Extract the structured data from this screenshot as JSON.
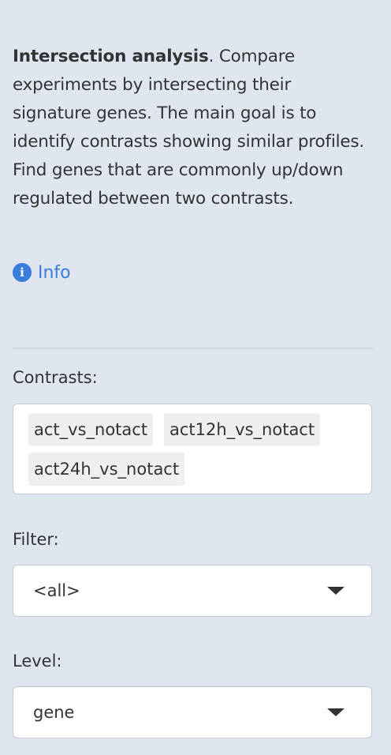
{
  "description": {
    "title": "Intersection analysis",
    "text": ". Compare experiments by intersecting their signature genes. The main goal is to identify contrasts showing similar profiles. Find genes that are commonly up/down regulated between two contrasts."
  },
  "info": {
    "icon": "info-circle-icon",
    "label": "Info"
  },
  "contrasts": {
    "label": "Contrasts:",
    "selected": [
      "act_vs_notact",
      "act12h_vs_notact",
      "act24h_vs_notact"
    ]
  },
  "filter": {
    "label": "Filter:",
    "value": "<all>"
  },
  "level": {
    "label": "Level:",
    "value": "gene"
  },
  "colors": {
    "background": "#dfe6f0",
    "link": "#3b7ddd",
    "text": "#333333"
  }
}
